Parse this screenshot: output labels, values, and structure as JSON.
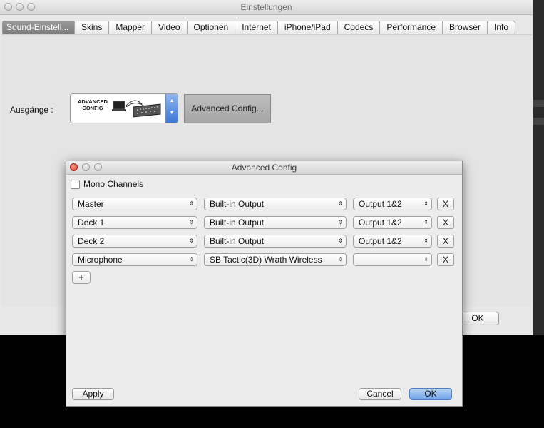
{
  "main_window": {
    "title": "Einstellungen",
    "tabs": [
      "Sound-Einstell...",
      "Skins",
      "Mapper",
      "Video",
      "Optionen",
      "Internet",
      "iPhone/iPad",
      "Codecs",
      "Performance",
      "Browser",
      "Info"
    ],
    "active_tab": "Sound-Einstell...",
    "outputs_label": "Ausgänge :",
    "skin_logo_text": "ADVANCED CONFIG",
    "advanced_button_label": "Advanced Config...",
    "ok_label": "OK"
  },
  "dialog": {
    "title": "Advanced Config",
    "mono_channels_label": "Mono Channels",
    "mono_channels_checked": false,
    "rows": [
      {
        "channel": "Master",
        "device": "Built-in Output",
        "output": "Output 1&2",
        "remove": "X"
      },
      {
        "channel": "Deck 1",
        "device": "Built-in Output",
        "output": "Output 1&2",
        "remove": "X"
      },
      {
        "channel": "Deck 2",
        "device": "Built-in Output",
        "output": "Output 1&2",
        "remove": "X"
      },
      {
        "channel": "Microphone",
        "device": "SB Tactic(3D) Wrath Wireless",
        "output": "",
        "remove": "X"
      }
    ],
    "add_label": "+",
    "apply_label": "Apply",
    "cancel_label": "Cancel",
    "ok_label": "OK"
  },
  "colors": {
    "accent_blue": "#6ea2e8",
    "close_red": "#d2322a",
    "active_tab": "#8a8a8a"
  }
}
